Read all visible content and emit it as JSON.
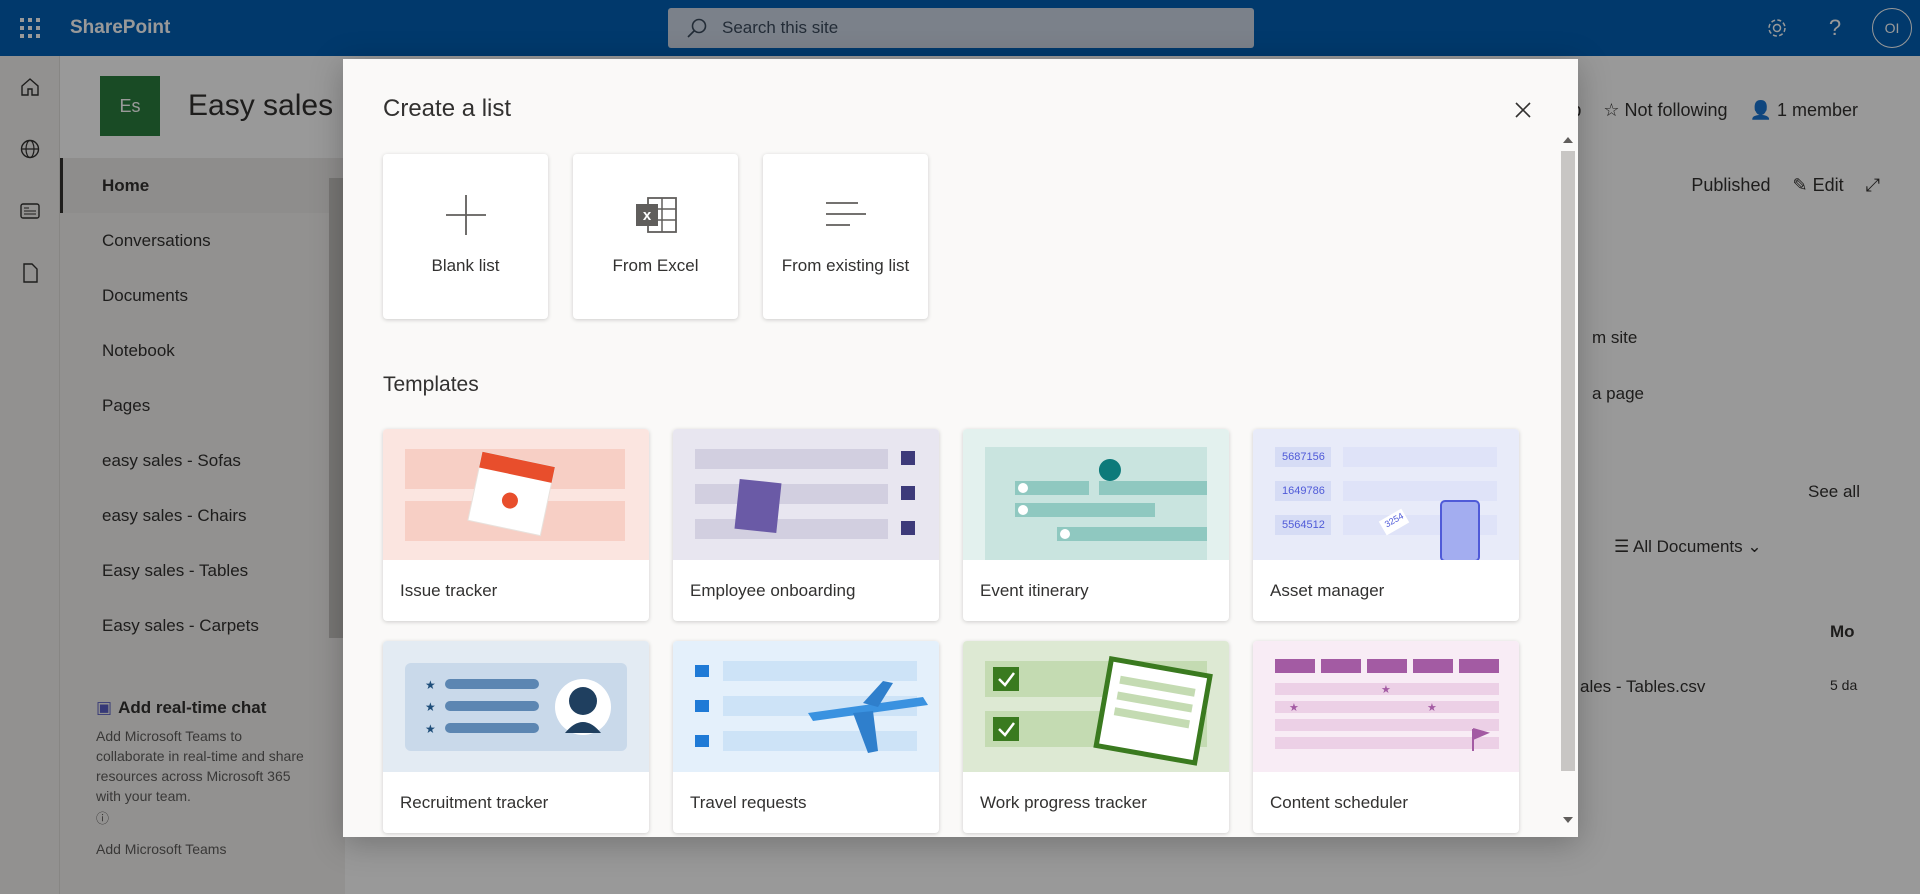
{
  "suite": {
    "app_name": "SharePoint",
    "search_placeholder": "Search this site",
    "avatar_initials": "OI"
  },
  "site": {
    "logo_initials": "Es",
    "title": "Easy sales",
    "actions": {
      "group_fragment": "up",
      "follow": "Not following",
      "members": "1 member"
    },
    "command": {
      "status": "Published",
      "edit": "Edit"
    }
  },
  "leftnav": {
    "items": [
      {
        "label": "Home"
      },
      {
        "label": "Conversations"
      },
      {
        "label": "Documents"
      },
      {
        "label": "Notebook"
      },
      {
        "label": "Pages"
      },
      {
        "label": "easy sales - Sofas"
      },
      {
        "label": "easy sales - Chairs"
      },
      {
        "label": "Easy sales - Tables"
      },
      {
        "label": "Easy sales - Carpets"
      }
    ]
  },
  "chat": {
    "title": "Add real-time chat",
    "body": "Add Microsoft Teams to collaborate in real-time and share resources across Microsoft 365 with your team.",
    "link": "Add Microsoft Teams"
  },
  "background": {
    "team_site_fragment": "m site",
    "page_fragment": "a page",
    "see_all": "See all",
    "view": "All Documents",
    "col_modified": "Mo",
    "file_name_fragment": "ales - Tables.csv",
    "file_modified_fragment": "5 da"
  },
  "dialog": {
    "title": "Create a list",
    "create_options": [
      {
        "label": "Blank list",
        "icon": "plus-icon"
      },
      {
        "label": "From Excel",
        "icon": "excel-icon"
      },
      {
        "label": "From existing list",
        "icon": "lines-icon"
      }
    ],
    "templates_heading": "Templates",
    "templates": [
      {
        "label": "Issue tracker",
        "bg": "#fbe5e0"
      },
      {
        "label": "Employee onboarding",
        "bg": "#e8e6f0"
      },
      {
        "label": "Event itinerary",
        "bg": "#e3f1ee"
      },
      {
        "label": "Asset manager",
        "bg": "#e8ebf9"
      },
      {
        "label": "Recruitment tracker",
        "bg": "#e3ebf3"
      },
      {
        "label": "Travel requests",
        "bg": "#e4f0fb"
      },
      {
        "label": "Work progress tracker",
        "bg": "#dde9d3"
      },
      {
        "label": "Content scheduler",
        "bg": "#f8ecf5"
      }
    ],
    "asset_numbers": [
      "5687156",
      "1649786",
      "5564512"
    ],
    "asset_tag": "3254"
  }
}
